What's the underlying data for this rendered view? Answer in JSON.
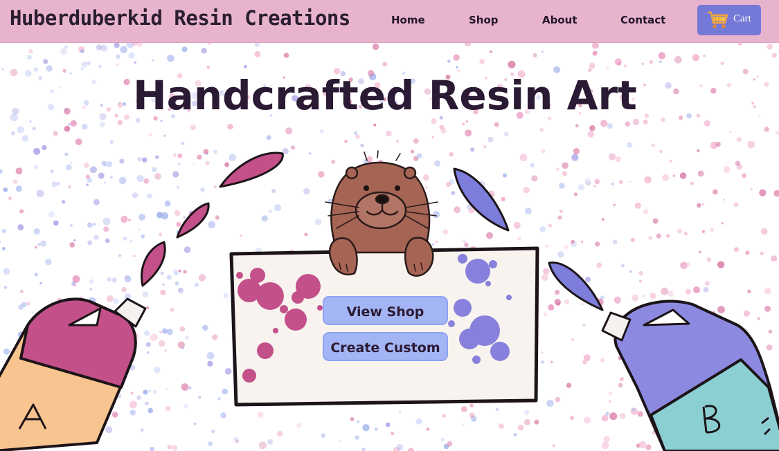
{
  "header": {
    "brand": "Huberduberkid Resin Creations",
    "nav": [
      {
        "label": "Home"
      },
      {
        "label": "Shop"
      },
      {
        "label": "About"
      },
      {
        "label": "Contact"
      }
    ],
    "cart_label": "Cart",
    "cart_icon": "shopping-cart-icon"
  },
  "hero": {
    "title": "Handcrafted Resin Art",
    "buttons": {
      "view_shop": "View Shop",
      "create_custom": "Create Custom"
    },
    "bottle_a_letter": "A",
    "bottle_b_letter": "B"
  },
  "colors": {
    "navbar": "#e8b4cd",
    "cart_button": "#7479d8",
    "cta_button": "#a4b5f5",
    "title_text": "#2b1a33",
    "resin_pink": "#c4508a",
    "resin_purple": "#7d7ddc",
    "resin_teal": "#8ccfd3",
    "resin_peach": "#f8c48f",
    "otter": "#a56454"
  }
}
